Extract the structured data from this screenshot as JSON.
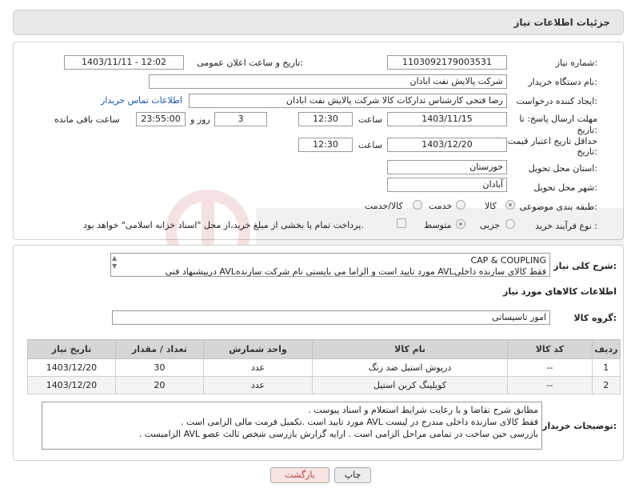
{
  "header": {
    "title": "جزئیات اطلاعات نیاز"
  },
  "form": {
    "need_number_label": "شماره نیاز:",
    "need_number": "1103092179003531",
    "announce_label": "تاریخ و ساعت اعلان عمومی:",
    "announce_value": "1403/11/11 - 12:02",
    "buyer_label": "نام دستگاه خریدار:",
    "buyer_value": "شرکت پالایش نفت ابادان",
    "creator_label": "ایجاد کننده درخواست:",
    "creator_value": "رضا فتحی کارشناس تدارکات کالا  شرکت پالایش نفت ابادان",
    "contact_link": "اطلاعات تماس خریدار",
    "deadline_label_1": "مهلت ارسال پاسخ: تا",
    "deadline_label_2": "تاریخ:",
    "deadline_date": "1403/11/15",
    "time_label": "ساعت",
    "deadline_time": "12:30",
    "days_value": "3",
    "days_label": "روز و",
    "remaining_time": "23:55:00",
    "remaining_label": "ساعت باقی مانده",
    "validity_label_1": "حداقل تاریخ اعتبار قیمت: تا",
    "validity_label_2": "تاریخ:",
    "validity_date": "1403/12/20",
    "validity_time": "12:30",
    "province_label": "استان محل تحویل:",
    "province_value": "خوزستان",
    "city_label": "شهر محل تحویل:",
    "city_value": "آبادان",
    "category_label": "طبقه بندی موضوعی:",
    "cat_goods": "کالا",
    "cat_service": "خدمت",
    "cat_both": "کالا/خدمت",
    "process_label": "نوع فرآیند خرید :",
    "proc_partial": "جزیی",
    "proc_medium": "متوسط",
    "payment_note": "پرداخت تمام یا بخشی از مبلغ خرید،از محل \"اسناد خزانه اسلامی\" خواهد بود."
  },
  "description": {
    "label": "شرح کلی نیاز:",
    "line1": "CAP & COUPLING",
    "line2": "فقط کالای سازنده داخلیAVL مورد تایید است و الزاما می بایستی نام شرکت سازندهAVL درپیشنهاد فنی"
  },
  "goods_info_label": "اطلاعات کالاهای مورد نیاز",
  "goods_group_label": "گروه کالا:",
  "goods_group_value": "امور تاسیساتی",
  "table": {
    "headers": [
      "ردیف",
      "کد کالا",
      "نام کالا",
      "واحد شمارش",
      "تعداد / مقدار",
      "تاریخ نیاز"
    ],
    "rows": [
      [
        "1",
        "--",
        "درپوش استیل ضد زنگ",
        "عدد",
        "30",
        "1403/12/20"
      ],
      [
        "2",
        "--",
        "کوپلینگ کربن استیل",
        "عدد",
        "20",
        "1403/12/20"
      ]
    ]
  },
  "notes": {
    "label": "توضیحات خریدار:",
    "line1": "مطابق شرح تقاضا و با رعایت شرایط استعلام و اسناد پیوست .",
    "line2": "فقط کالای سازنده داخلی مندرج در لیست AVL مورد تایید است .تکمیل فرمت مالی الزامی است .",
    "line3": "بازرسی حین ساخت در تمامی مراحل الزامی است . ارایه گزارش بازرسی شخص ثالث عضو  AVL  الزامیست ."
  },
  "buttons": {
    "print": "چاپ",
    "back": "بازگشت"
  }
}
